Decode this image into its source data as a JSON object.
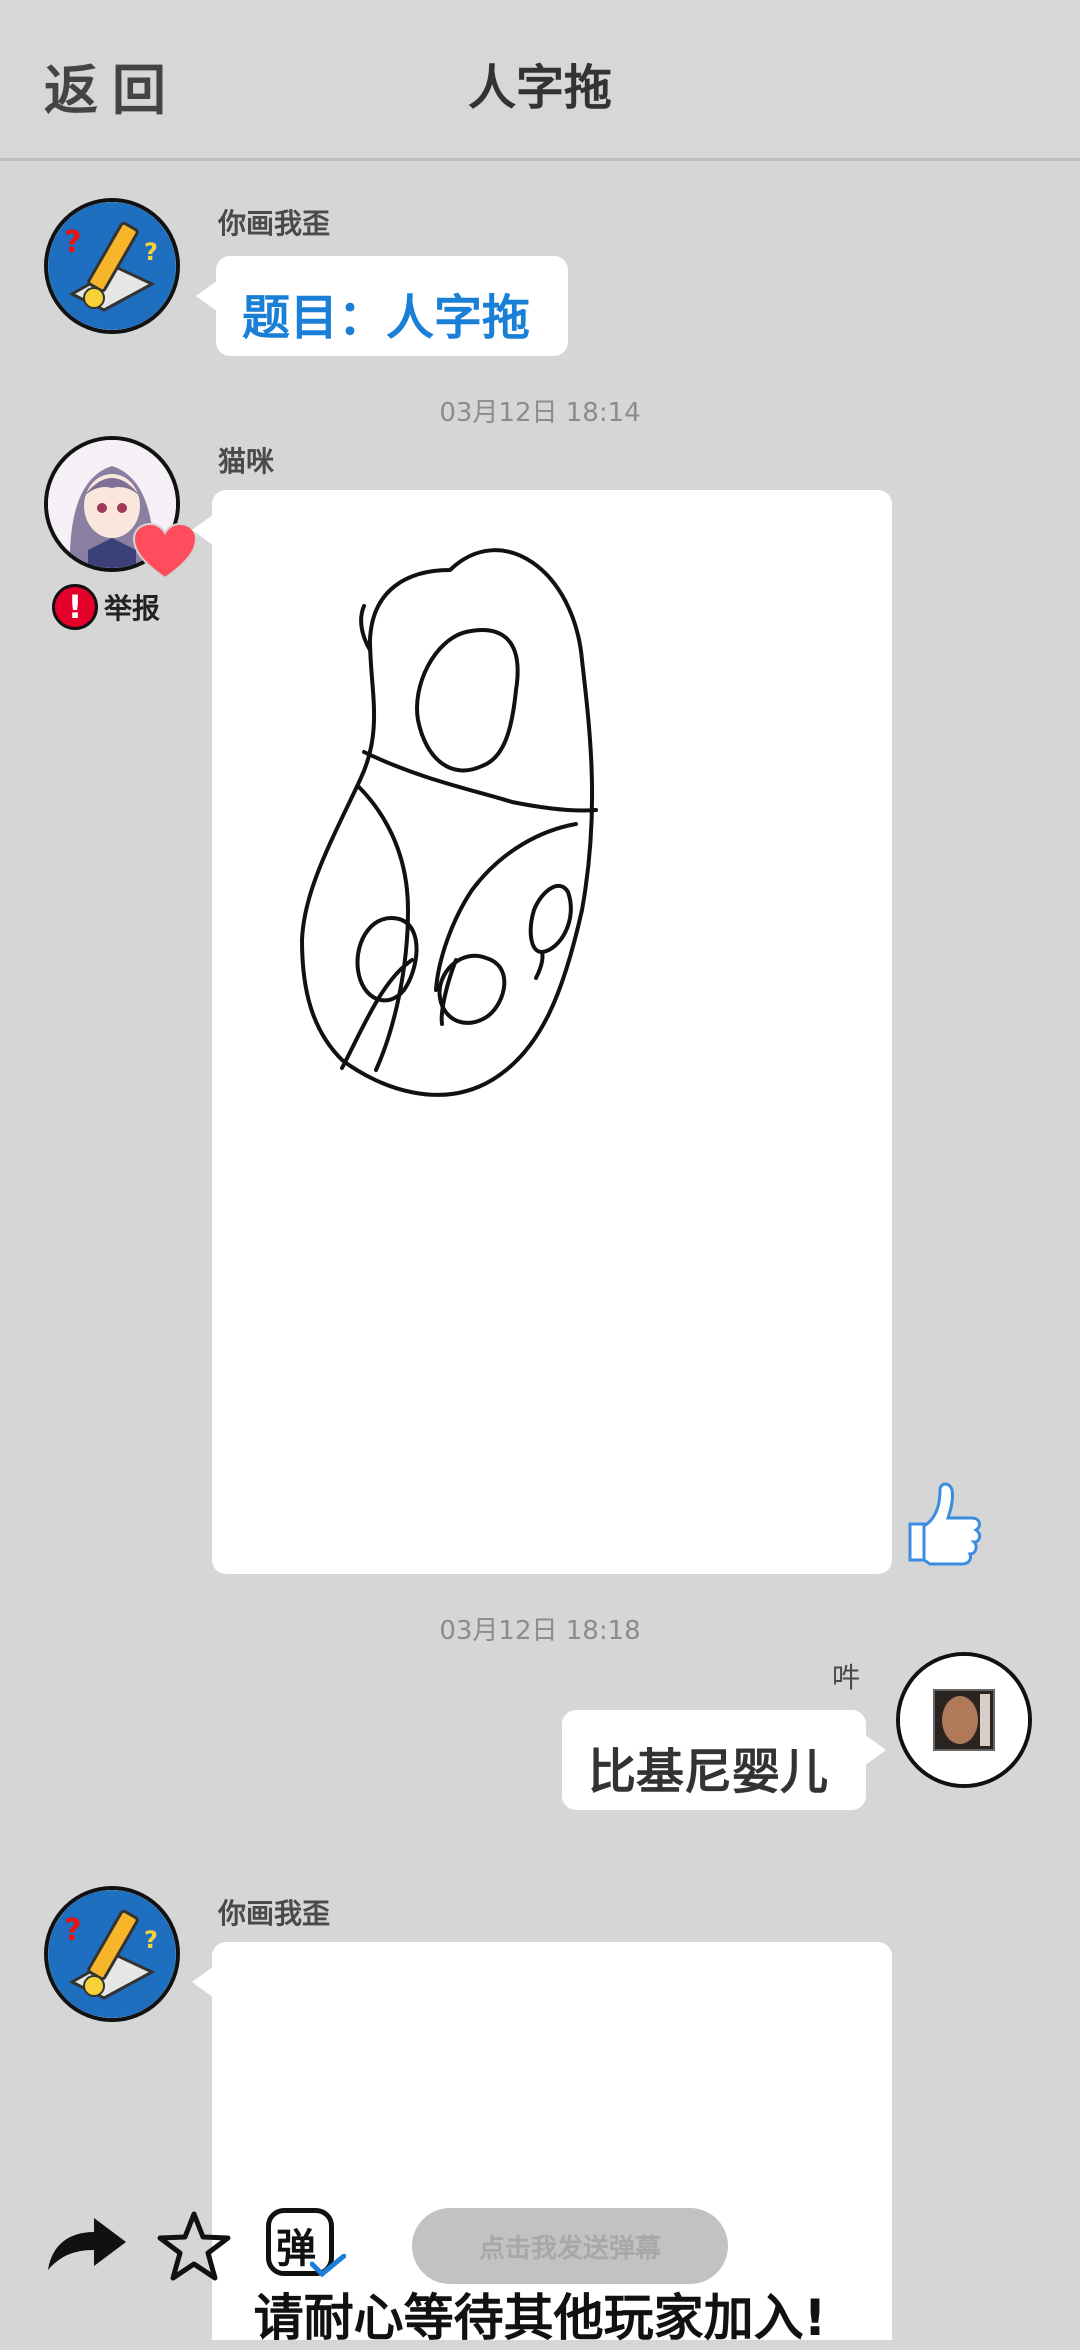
{
  "header": {
    "back_label": "返回",
    "title": "人字拖"
  },
  "messages": [
    {
      "sender": "你画我歪",
      "text": "题目：人字拖"
    },
    {
      "timestamp": "03月12日  18:14"
    },
    {
      "sender": "猫咪",
      "report_label": "举报"
    },
    {
      "timestamp": "03月12日  18:18"
    },
    {
      "sender": "吽",
      "text": "比基尼婴儿"
    },
    {
      "sender": "你画我歪"
    }
  ],
  "toolbar": {
    "danmaku_placeholder": "点击我发送弹幕",
    "danmaku_icon_char": "弹",
    "status_text": "请耐心等待其他玩家加入!"
  },
  "colors": {
    "topic_blue": "#1a7fd6",
    "like_blue": "#3a8de0",
    "report_red": "#e5002b",
    "heart_red": "#ff4d5e"
  },
  "icons": [
    "share-icon",
    "star-icon",
    "danmaku-icon",
    "thumbs-up-icon",
    "heart-icon",
    "report-icon"
  ]
}
